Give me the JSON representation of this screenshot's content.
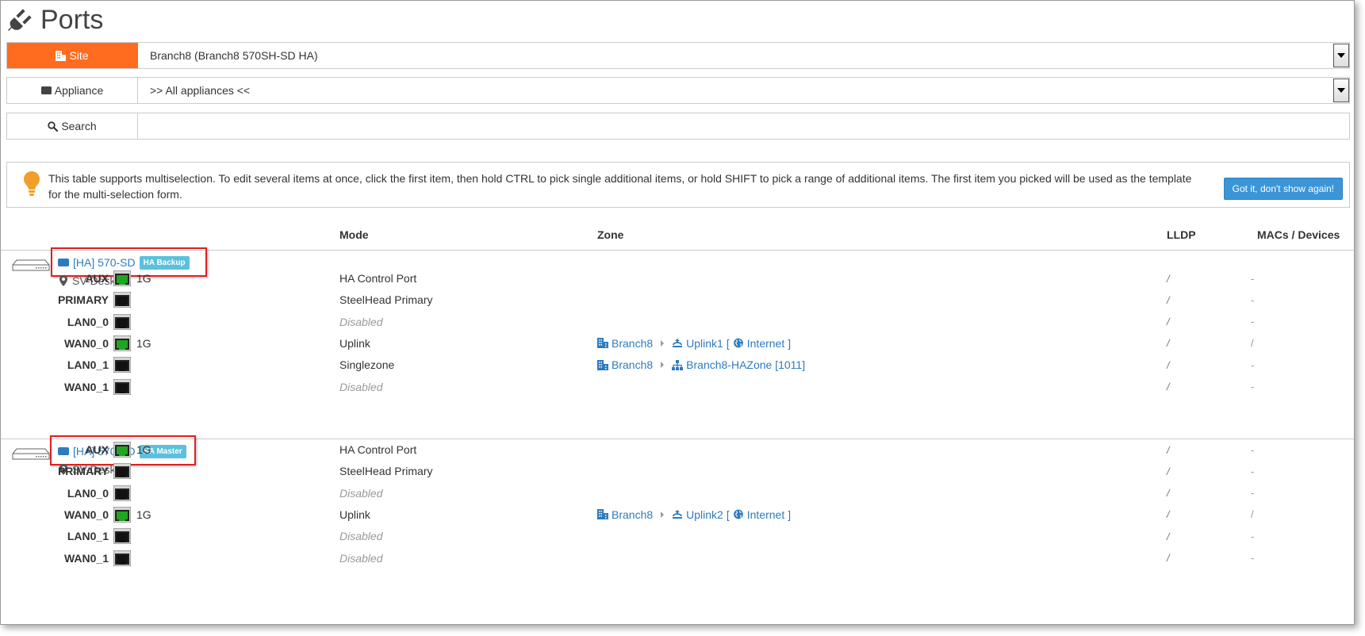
{
  "page": {
    "title": "Ports",
    "title_icon": "plug-icon"
  },
  "filters": {
    "site": {
      "label": "Site",
      "icon": "building-icon",
      "value": "Branch8 (Branch8 570SH-SD HA)"
    },
    "appliance": {
      "label": "Appliance",
      "icon": "appliance-icon",
      "value": ">> All appliances <<"
    },
    "search": {
      "label": "Search",
      "icon": "search-icon",
      "value": ""
    }
  },
  "info": {
    "icon": "lightbulb-icon",
    "text": "This table supports multiselection. To edit several items at once, click the first item, then hold CTRL to pick single additional items, or hold SHIFT to pick a range of additional items. The first item you picked will be used as the template for the multi-selection form.",
    "button": "Got it, don't show again!"
  },
  "columns": {
    "mode": "Mode",
    "zone": "Zone",
    "lldp": "LLDP",
    "macs": "MACs / Devices"
  },
  "colors": {
    "accent": "#ff6b1f",
    "link": "#2f7bbf",
    "badge": "#5bc0de",
    "highlight": "#e02020",
    "port_active": "#1fa51f"
  },
  "appliances": [
    {
      "name": "[HA] 570-SD",
      "badge": "HA Backup",
      "location": "SV-Desk-2",
      "ports": [
        {
          "name": "AUX",
          "active": true,
          "speed": "1G",
          "mode": "HA Control Port",
          "disabled": false,
          "zone": null,
          "lldp": "/",
          "macs": "-"
        },
        {
          "name": "PRIMARY",
          "active": false,
          "speed": "",
          "mode": "SteelHead Primary",
          "disabled": false,
          "zone": null,
          "lldp": "/",
          "macs": "-"
        },
        {
          "name": "LAN0_0",
          "active": false,
          "speed": "",
          "mode": "Disabled",
          "disabled": true,
          "zone": null,
          "lldp": "/",
          "macs": "-"
        },
        {
          "name": "WAN0_0",
          "active": true,
          "speed": "1G",
          "mode": "Uplink",
          "disabled": false,
          "zone": {
            "site": "Branch8",
            "target": "Uplink1",
            "bracket_open": "[",
            "network": "Internet",
            "bracket_close": "]",
            "target_icon": "uplink-icon"
          },
          "lldp": "/",
          "macs": "/"
        },
        {
          "name": "LAN0_1",
          "active": false,
          "speed": "",
          "mode": "Singlezone",
          "disabled": false,
          "zone": {
            "site": "Branch8",
            "target": "Branch8-HAZone [1011]",
            "target_icon": "sitemap-icon"
          },
          "lldp": "/",
          "macs": "-"
        },
        {
          "name": "WAN0_1",
          "active": false,
          "speed": "",
          "mode": "Disabled",
          "disabled": true,
          "zone": null,
          "lldp": "/",
          "macs": "-"
        }
      ]
    },
    {
      "name": "[HA] 570-SD",
      "badge": "HA Master",
      "location": "SV-Desk-1",
      "ports": [
        {
          "name": "AUX",
          "active": true,
          "speed": "1G",
          "mode": "HA Control Port",
          "disabled": false,
          "zone": null,
          "lldp": "/",
          "macs": "-"
        },
        {
          "name": "PRIMARY",
          "active": false,
          "speed": "",
          "mode": "SteelHead Primary",
          "disabled": false,
          "zone": null,
          "lldp": "/",
          "macs": "-"
        },
        {
          "name": "LAN0_0",
          "active": false,
          "speed": "",
          "mode": "Disabled",
          "disabled": true,
          "zone": null,
          "lldp": "/",
          "macs": "-"
        },
        {
          "name": "WAN0_0",
          "active": true,
          "speed": "1G",
          "mode": "Uplink",
          "disabled": false,
          "zone": {
            "site": "Branch8",
            "target": "Uplink2",
            "bracket_open": "[",
            "network": "Internet",
            "bracket_close": "]",
            "target_icon": "uplink-icon"
          },
          "lldp": "/",
          "macs": "/"
        },
        {
          "name": "LAN0_1",
          "active": false,
          "speed": "",
          "mode": "Disabled",
          "disabled": true,
          "zone": null,
          "lldp": "/",
          "macs": "-"
        },
        {
          "name": "WAN0_1",
          "active": false,
          "speed": "",
          "mode": "Disabled",
          "disabled": true,
          "zone": null,
          "lldp": "/",
          "macs": "-"
        }
      ]
    }
  ]
}
